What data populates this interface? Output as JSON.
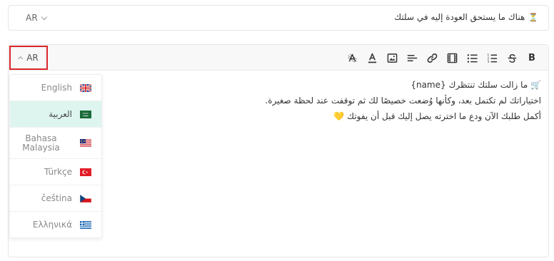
{
  "subject": {
    "language": "AR",
    "text": "هناك ما يستحق العودة إليه في سلتك",
    "icon": "hourglass-icon"
  },
  "editor": {
    "language_toggle": "AR",
    "toolbar": [
      {
        "name": "bold-button",
        "glyph": "B"
      },
      {
        "name": "strikethrough-button",
        "icon": "strikethrough-icon"
      },
      {
        "name": "ordered-list-button",
        "icon": "ordered-list-icon"
      },
      {
        "name": "bullet-list-button",
        "icon": "bullet-list-icon"
      },
      {
        "name": "video-button",
        "icon": "film-icon"
      },
      {
        "name": "link-button",
        "icon": "link-icon"
      },
      {
        "name": "align-button",
        "icon": "align-left-icon"
      },
      {
        "name": "image-button",
        "icon": "image-icon"
      },
      {
        "name": "text-color-button",
        "icon": "text-color-icon"
      },
      {
        "name": "clear-format-button",
        "icon": "clear-format-icon"
      }
    ],
    "content": {
      "line1": "🛒 ما زالت سلتك تنتظرك {name}",
      "line2": "اختياراتك لم تكتمل بعد، وكأنها وُضعت خصيصًا لك ثم توقفت عند لحظة صغيرة.",
      "line3": "أكمل طلبك الآن ودع ما اخترته يصل إليك قبل أن يفوتك",
      "line3_emoji": "💛"
    }
  },
  "languages": [
    {
      "label": "English",
      "flag": "uk-flag",
      "selected": false
    },
    {
      "label": "العربية",
      "flag": "saudi-flag",
      "selected": true
    },
    {
      "label": "Bahasa Malaysia",
      "flag": "malaysia-flag",
      "selected": false
    },
    {
      "label": "Türkçe",
      "flag": "turkey-flag",
      "selected": false
    },
    {
      "label": "čeština",
      "flag": "czech-flag",
      "selected": false
    },
    {
      "label": "Ελληνικά",
      "flag": "greece-flag",
      "selected": false
    }
  ],
  "colors": {
    "highlight_border": "#d9262c",
    "selected_bg": "#ddf5ee"
  }
}
